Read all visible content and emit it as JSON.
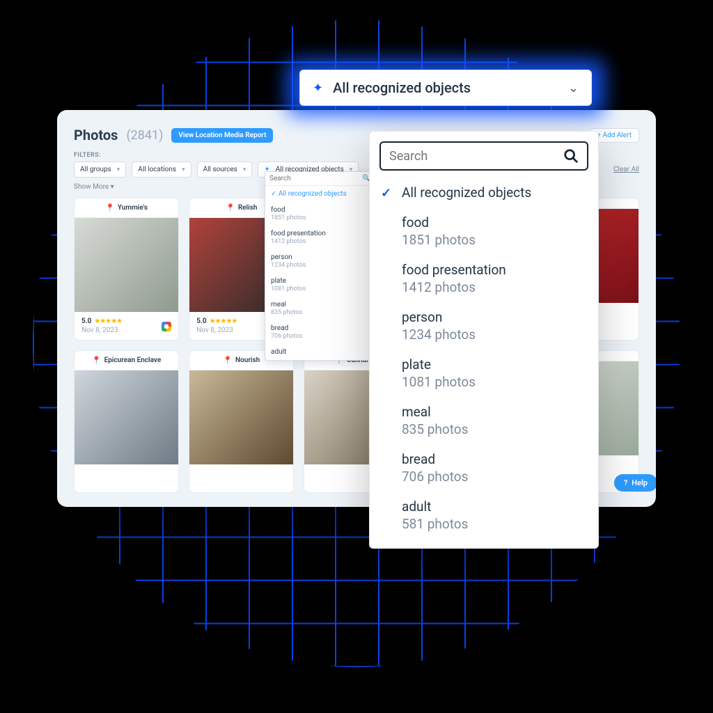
{
  "header": {
    "title": "Photos",
    "count": "(2841)",
    "report_button": "View Location Media Report",
    "add_alert_button": "+ Add Alert"
  },
  "filters": {
    "label": "FILTERS:",
    "clear_all": "Clear All",
    "show_more": "Show More",
    "chips": [
      {
        "label": "All groups"
      },
      {
        "label": "All locations"
      },
      {
        "label": "All sources"
      },
      {
        "label": "All recognized objects",
        "spark": true
      }
    ]
  },
  "help_button": "Help",
  "cards": [
    {
      "loc": "Yummie's",
      "img": "img0",
      "rating": "5.0",
      "date": "Nov 8, 2023"
    },
    {
      "loc": "Relish",
      "img": "img1",
      "rating": "5.0",
      "date": "Nov 8, 2023"
    },
    {
      "loc": "",
      "img": "img2",
      "rating": "",
      "date": ""
    },
    {
      "loc": "",
      "img": "",
      "rating": "",
      "date": ""
    },
    {
      "loc": "",
      "img": "img3",
      "rating": "",
      "date": ""
    },
    {
      "loc": "Epicurean Enclave",
      "img": "img4",
      "rating": "",
      "date": ""
    },
    {
      "loc": "Nourish",
      "img": "img5",
      "rating": "",
      "date": ""
    },
    {
      "loc": "Culinary C",
      "img": "img6",
      "rating": "",
      "date": ""
    },
    {
      "loc": "",
      "img": "",
      "rating": "",
      "date": ""
    },
    {
      "loc": "",
      "img": "img7",
      "rating": "",
      "date": ""
    }
  ],
  "mini_popup": {
    "search_placeholder": "Search",
    "selected": "All recognized objects",
    "items": [
      {
        "label": "food",
        "sub": "1851 photos"
      },
      {
        "label": "food presentation",
        "sub": "1412 photos"
      },
      {
        "label": "person",
        "sub": "1234 photos"
      },
      {
        "label": "plate",
        "sub": "1081 photos"
      },
      {
        "label": "meal",
        "sub": "835 photos"
      },
      {
        "label": "bread",
        "sub": "706 photos"
      },
      {
        "label": "adult",
        "sub": ""
      }
    ]
  },
  "big_dropdown": {
    "button_label": "All recognized objects",
    "search_placeholder": "Search",
    "selected_label": "All recognized objects",
    "options": [
      {
        "label": "food",
        "count": "1851 photos"
      },
      {
        "label": "food presentation",
        "count": "1412 photos"
      },
      {
        "label": "person",
        "count": "1234 photos"
      },
      {
        "label": "plate",
        "count": "1081 photos"
      },
      {
        "label": "meal",
        "count": "835 photos"
      },
      {
        "label": "bread",
        "count": "706 photos"
      },
      {
        "label": "adult",
        "count": "581 photos"
      }
    ]
  }
}
